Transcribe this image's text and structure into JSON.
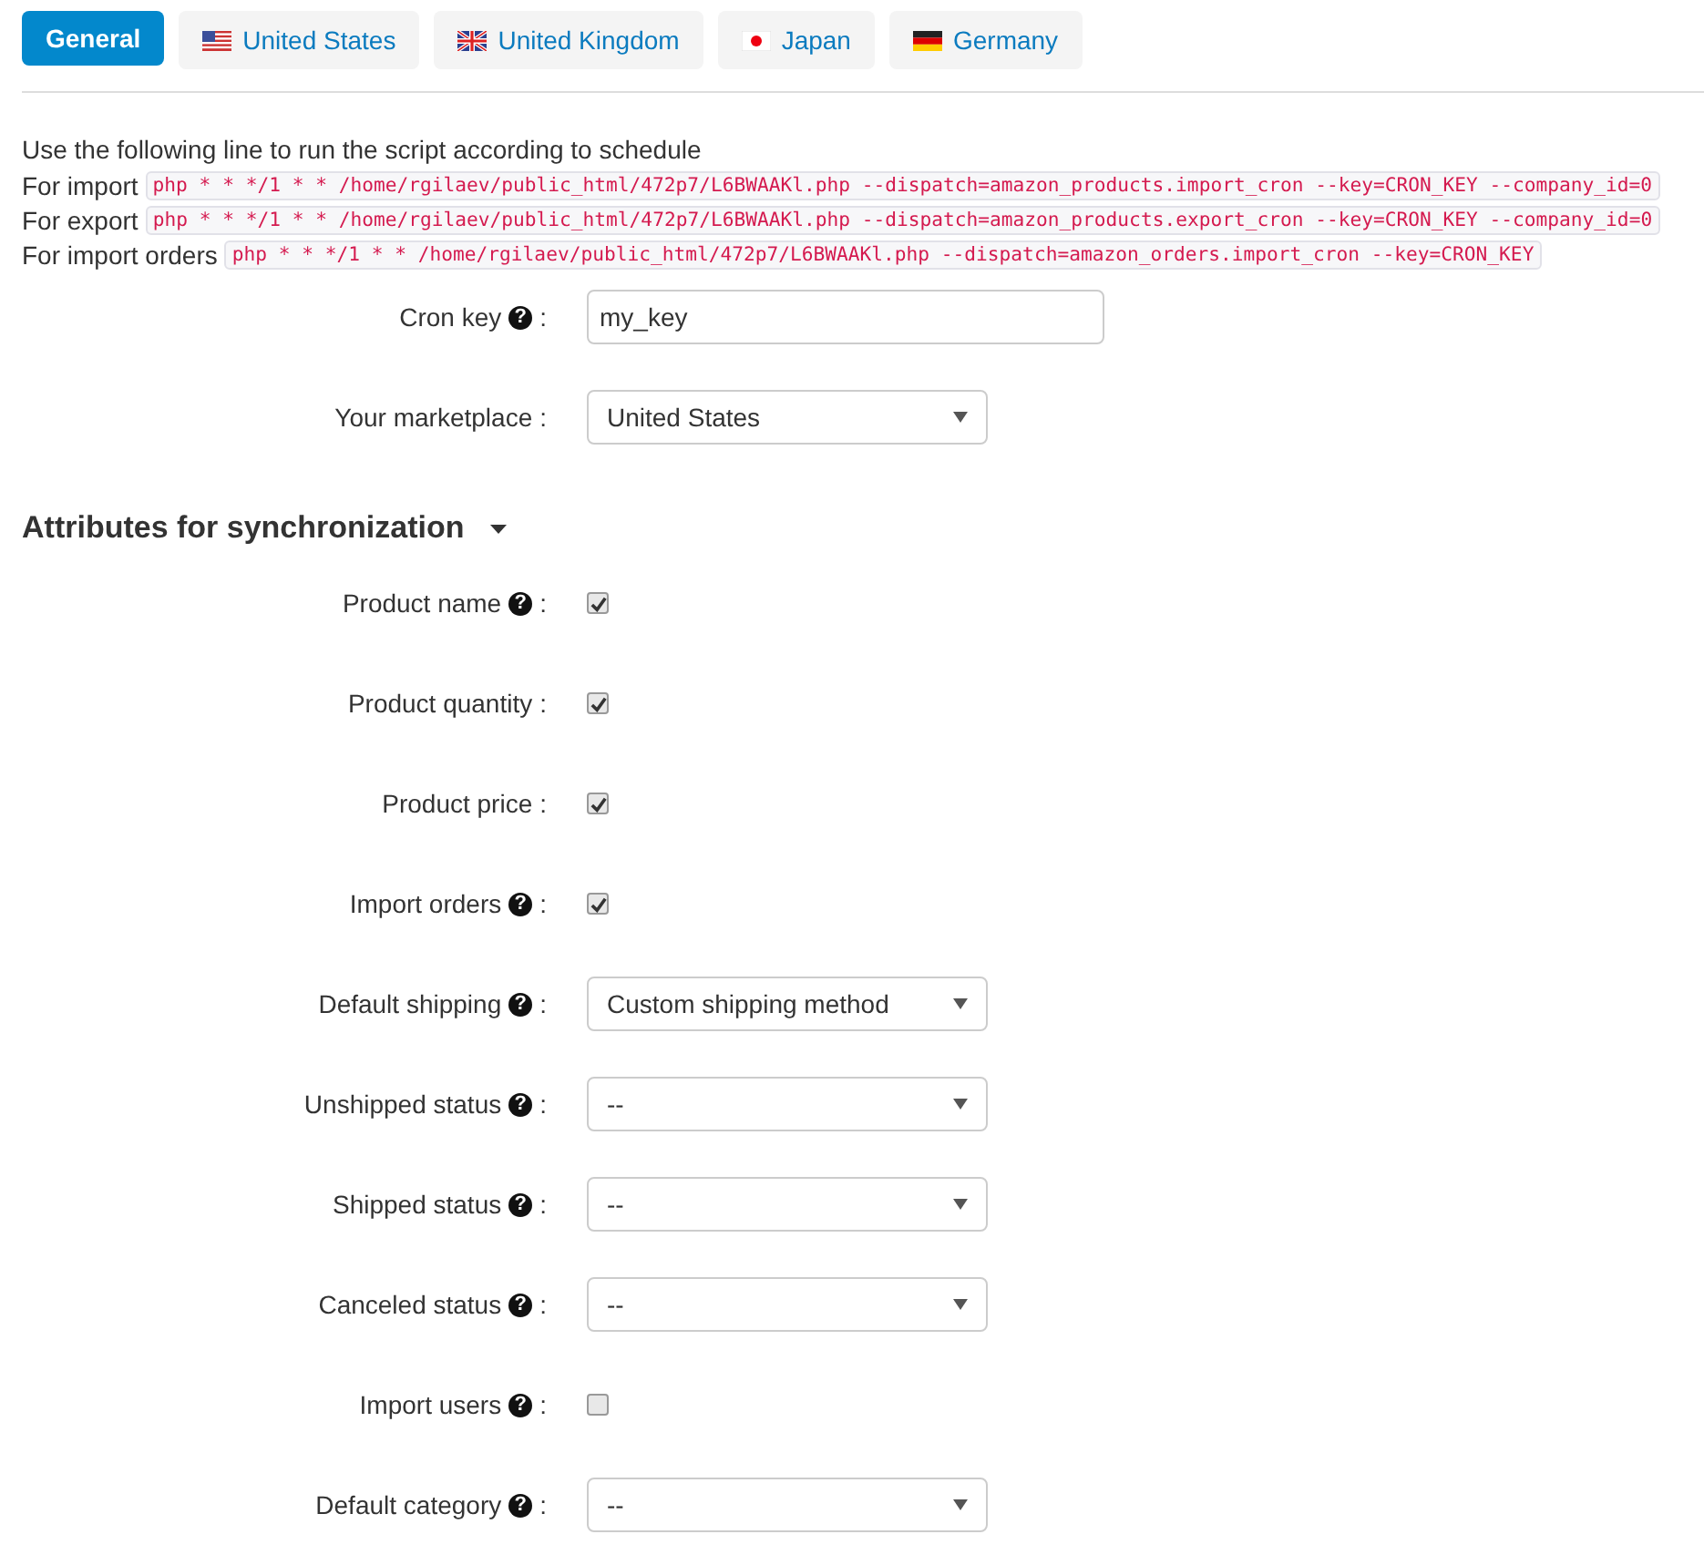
{
  "tabs": [
    {
      "label": "General",
      "kind": "plain",
      "selected": true
    },
    {
      "label": "United States",
      "kind": "us",
      "selected": false
    },
    {
      "label": "United Kingdom",
      "kind": "uk",
      "selected": false
    },
    {
      "label": "Japan",
      "kind": "jp",
      "selected": false
    },
    {
      "label": "Germany",
      "kind": "de",
      "selected": false
    }
  ],
  "instructions": {
    "intro": "Use the following line to run the script according to schedule",
    "commands": [
      {
        "label": "For import",
        "code": "php * * */1 * * /home/rgilaev/public_html/472p7/L6BWAAKl.php --dispatch=amazon_products.import_cron --key=CRON_KEY --company_id=0"
      },
      {
        "label": "For export",
        "code": "php * * */1 * * /home/rgilaev/public_html/472p7/L6BWAAKl.php --dispatch=amazon_products.export_cron --key=CRON_KEY --company_id=0"
      },
      {
        "label": "For import orders",
        "code": "php * * */1 * * /home/rgilaev/public_html/472p7/L6BWAAKl.php --dispatch=amazon_orders.import_cron --key=CRON_KEY"
      }
    ]
  },
  "settings": [
    {
      "label": "Cron key",
      "help": "?",
      "colon": ":",
      "kind": "text",
      "value": "my_key"
    },
    {
      "label": "Your marketplace",
      "colon": ":",
      "kind": "select",
      "value": "United States"
    }
  ],
  "section": {
    "title": "Attributes for synchronization",
    "expanded": true,
    "fields": [
      {
        "label": "Product name",
        "help": "?",
        "colon": ":",
        "kind": "checkbox",
        "checked": true
      },
      {
        "label": "Product quantity",
        "colon": ":",
        "kind": "checkbox",
        "checked": true
      },
      {
        "label": "Product price",
        "colon": ":",
        "kind": "checkbox",
        "checked": true
      },
      {
        "label": "Import orders",
        "help": "?",
        "colon": ":",
        "kind": "checkbox",
        "checked": true
      },
      {
        "label": "Default shipping",
        "help": "?",
        "colon": ":",
        "kind": "select",
        "value": "Custom shipping method"
      },
      {
        "label": "Unshipped status",
        "help": "?",
        "colon": ":",
        "kind": "select",
        "value": "--"
      },
      {
        "label": "Shipped status",
        "help": "?",
        "colon": ":",
        "kind": "select",
        "value": "--"
      },
      {
        "label": "Canceled status",
        "help": "?",
        "colon": ":",
        "kind": "select",
        "value": "--"
      },
      {
        "label": "Import users",
        "help": "?",
        "colon": ":",
        "kind": "checkbox",
        "checked": false
      },
      {
        "label": "Default category",
        "help": "?",
        "colon": ":",
        "kind": "select",
        "value": "--"
      }
    ]
  }
}
